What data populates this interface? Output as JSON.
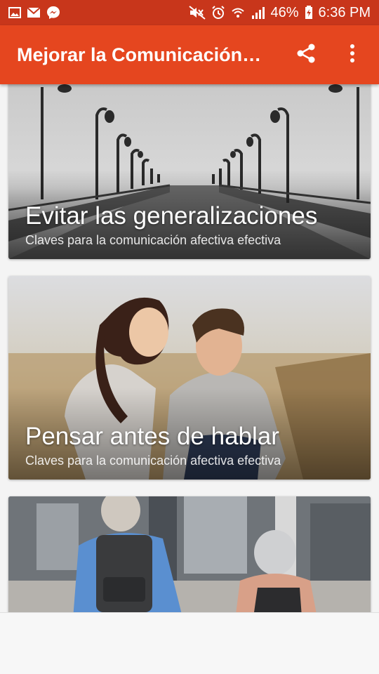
{
  "status_bar": {
    "left_icons": [
      "image-icon",
      "mail-icon",
      "messenger-icon"
    ],
    "right_icons": [
      "mute-icon",
      "alarm-icon",
      "wifi-icon",
      "signal-icon",
      "battery-charging-icon"
    ],
    "battery": "46%",
    "time": "6:36 PM"
  },
  "app_bar": {
    "title": "Mejorar la Comunicación…",
    "share_icon": "share-icon",
    "menu_icon": "more-vert-icon"
  },
  "cards": [
    {
      "title": "Evitar las generalizaciones",
      "subtitle": "Claves para la comunicación afectiva efectiva"
    },
    {
      "title": "Pensar antes de hablar",
      "subtitle": "Claves para la comunicación afectiva efectiva"
    },
    {
      "title": "",
      "subtitle": ""
    }
  ],
  "colors": {
    "status_bar": "#c8361b",
    "app_bar": "#e5461f",
    "background": "#f4f4f4"
  }
}
